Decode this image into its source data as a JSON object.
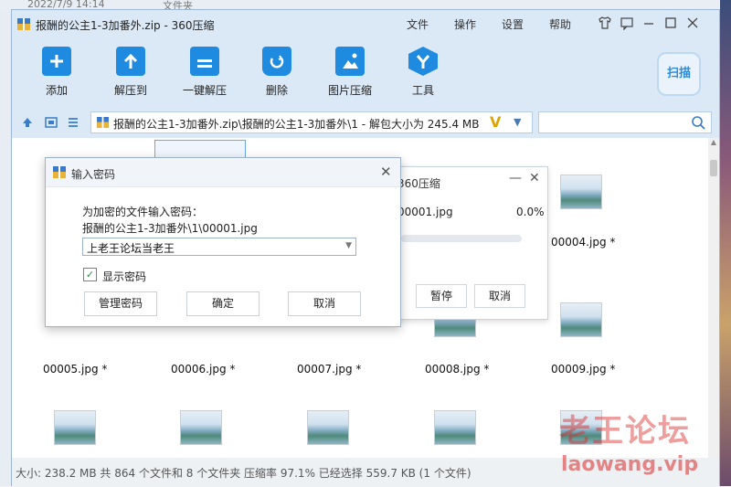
{
  "background": {
    "date_text": "2022/7/9 14:14",
    "type_text": "文件夹"
  },
  "window": {
    "title": "报酬的公主1-3加番外.zip - 360压缩",
    "menu": [
      "文件",
      "操作",
      "设置",
      "帮助"
    ]
  },
  "toolbar": {
    "items": [
      {
        "label": "添加",
        "icon": "add-icon"
      },
      {
        "label": "解压到",
        "icon": "extract-to-icon"
      },
      {
        "label": "一键解压",
        "icon": "one-click-extract-icon"
      },
      {
        "label": "删除",
        "icon": "delete-icon"
      },
      {
        "label": "图片压缩",
        "icon": "image-compress-icon"
      },
      {
        "label": "工具",
        "icon": "tools-icon"
      }
    ],
    "scan_label": "扫描"
  },
  "address": {
    "path": "报酬的公主1-3加番外.zip\\报酬的公主1-3加番外\\1 - 解包大小为 245.4 MB",
    "search_placeholder": ""
  },
  "files": {
    "row1": [
      "",
      "",
      "",
      "",
      "00004.jpg *"
    ],
    "row2": [
      "00005.jpg *",
      "00006.jpg *",
      "00007.jpg *",
      "00008.jpg *",
      "00009.jpg *"
    ]
  },
  "status": {
    "text": "大小: 238.2 MB 共 864 个文件和 8 个文件夹 压缩率 97.1% 已经选择 559.7 KB (1 个文件)"
  },
  "watermark": {
    "line1": "老王论坛",
    "line2": "laowang.vip"
  },
  "progress_dialog": {
    "title": "360压缩",
    "file": "00001.jpg",
    "percent_text": "0.0%",
    "progress": 0.0,
    "pause_label": "暂停",
    "cancel_label": "取消"
  },
  "password_dialog": {
    "title": "输入密码",
    "prompt": "为加密的文件输入密码：",
    "file": "报酬的公主1-3加番外\\1\\00001.jpg",
    "password_value": "上老王论坛当老王",
    "show_password_label": "显示密码",
    "show_password_checked": true,
    "manage_label": "管理密码",
    "ok_label": "确定",
    "cancel_label": "取消"
  },
  "colors": {
    "accent": "#1e8ae0",
    "titlebar": "#dbe9f7",
    "watermark": "#dc2828"
  }
}
